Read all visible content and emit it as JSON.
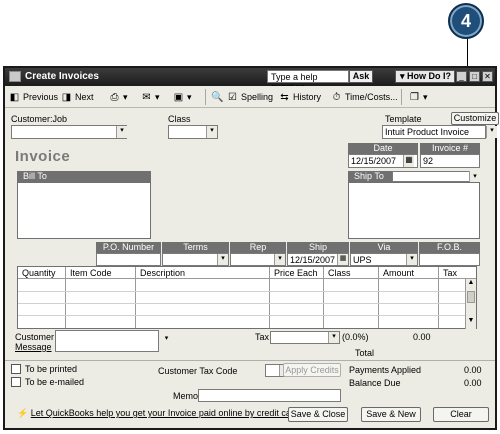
{
  "callout": {
    "number": "4"
  },
  "window": {
    "title": "Create Invoices",
    "help_input": "Type a help question",
    "ask_button": "Ask",
    "how_do_i": "How Do I?",
    "controls": [
      "_",
      "□",
      "✕"
    ]
  },
  "toolbar": {
    "previous": "Previous",
    "next": "Next",
    "spelling": "Spelling",
    "history": "History",
    "time_costs": "Time/Costs..."
  },
  "header": {
    "customer_job_label": "Customer:Job",
    "class_label": "Class",
    "template_label": "Template",
    "customize_button": "Customize",
    "template_value": "Intuit Product Invoice"
  },
  "invoice": {
    "title": "Invoice",
    "date_label": "Date",
    "date_value": "12/15/2007",
    "number_label": "Invoice #",
    "number_value": "92",
    "bill_to_label": "Bill To",
    "ship_to_label": "Ship To"
  },
  "shipping": {
    "po_label": "P.O. Number",
    "terms_label": "Terms",
    "rep_label": "Rep",
    "ship_label": "Ship",
    "ship_value": "12/15/2007",
    "via_label": "Via",
    "via_value": "UPS",
    "fob_label": "F.O.B."
  },
  "items_table": {
    "columns": [
      "Quantity",
      "Item Code",
      "Description",
      "Price Each",
      "Class",
      "Amount",
      "Tax"
    ]
  },
  "footer": {
    "customer_message_label_1": "Customer",
    "customer_message_label_2": "Message",
    "tax_label": "Tax",
    "tax_percent": "(0.0%)",
    "tax_amount": "0.00",
    "total_label": "Total",
    "to_be_printed": "To be printed",
    "to_be_emailed": "To be e-mailed",
    "customer_tax_code_label": "Customer Tax Code",
    "apply_credits": "Apply Credits",
    "payments_applied_label": "Payments Applied",
    "payments_applied_value": "0.00",
    "balance_due_label": "Balance Due",
    "balance_due_value": "0.00",
    "memo_label": "Memo",
    "promo_link": "Let QuickBooks help you get your Invoice paid online by credit card.",
    "save_close": "Save & Close",
    "save_new": "Save & New",
    "clear": "Clear"
  }
}
